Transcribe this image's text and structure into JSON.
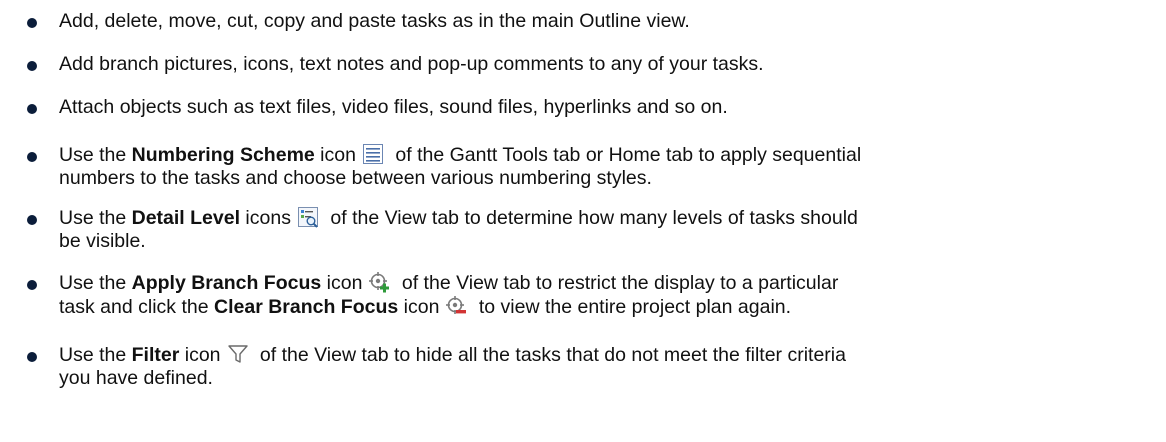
{
  "items": [
    {
      "text": "Add, delete, move, cut, copy and paste tasks as in the main Outline view."
    },
    {
      "text": "Add branch pictures, icons, text notes and pop-up comments to any of your tasks."
    },
    {
      "text": "Attach objects such as text files, video files, sound files, hyperlinks and so on."
    },
    {
      "pre": "Use the ",
      "bold": "Numbering Scheme",
      "mid": " icon",
      "post": " of the Gantt Tools tab or Home tab to apply sequential",
      "line2": "numbers to the tasks and choose between various numbering styles.",
      "icon": "numbering-scheme-icon"
    },
    {
      "pre": "Use the ",
      "bold": "Detail Level",
      "mid": " icons",
      "post": " of the View tab to determine how many levels of tasks should",
      "line2": "be visible.",
      "icon": "detail-level-icon"
    },
    {
      "pre": "Use the ",
      "bold": "Apply Branch Focus",
      "mid": " icon",
      "post": " of the View tab to restrict the display to a particular",
      "line2_pre": "task and click the ",
      "line2_bold": "Clear Branch Focus",
      "line2_mid": " icon",
      "line2_post": " to view the entire project plan again.",
      "icon": "apply-branch-focus-icon",
      "icon2": "clear-branch-focus-icon"
    },
    {
      "pre": "Use the ",
      "bold": "Filter",
      "mid": " icon",
      "post": " of the View tab to hide all the tasks that do not meet the filter criteria",
      "line2": "you have defined.",
      "icon": "filter-icon"
    }
  ]
}
